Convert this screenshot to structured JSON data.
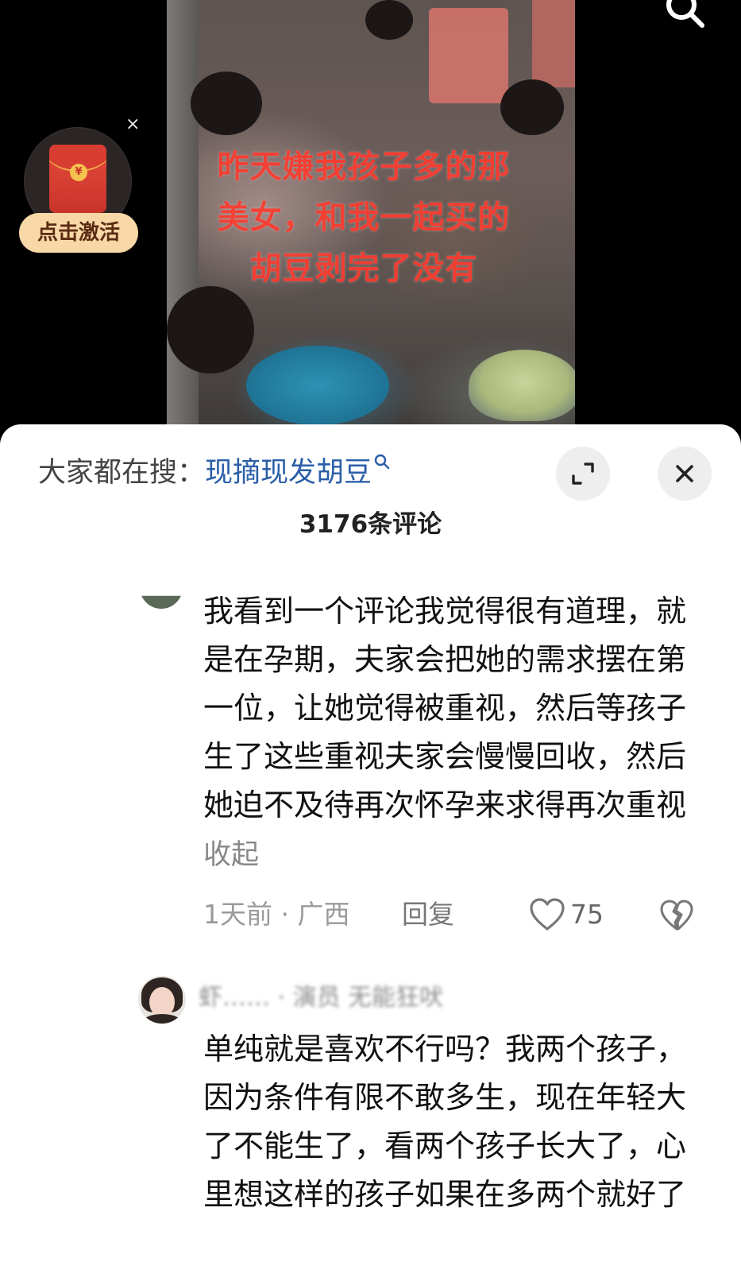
{
  "video": {
    "overlay_caption": "昨天嫌我孩子多的那美女，和我一起买的胡豆剥完了没有",
    "redpack": {
      "coin_symbol": "¥",
      "activate_label": "点击激活",
      "close_symbol": "×"
    }
  },
  "sheet": {
    "hot_search_label": "大家都在搜：",
    "hot_search_term": "现摘现发胡豆",
    "comment_count": "3176条评论"
  },
  "comments": [
    {
      "text": "我看到一个评论我觉得很有道理，就是在孕期，夫家会把她的需求摆在第一位，让她觉得被重视，然后等孩子生了这些重视夫家会慢慢回收，然后她迫不及待再次怀孕来求得再次重视",
      "collapse_label": "收起",
      "time_location": "1天前 · 广西",
      "reply_label": "回复",
      "likes": "75"
    },
    {
      "username": "虾…… · 演员 无能狂吠",
      "text": "单纯就是喜欢不行吗？我两个孩子，因为条件有限不敢多生，现在年轻大了不能生了，看两个孩子长大了，心里想这样的孩子如果在多两个就好了"
    }
  ],
  "colors": {
    "caption_red": "#ff3b2f",
    "link_blue": "#2a5ea8",
    "redpack_button": "#f7d8a6"
  }
}
